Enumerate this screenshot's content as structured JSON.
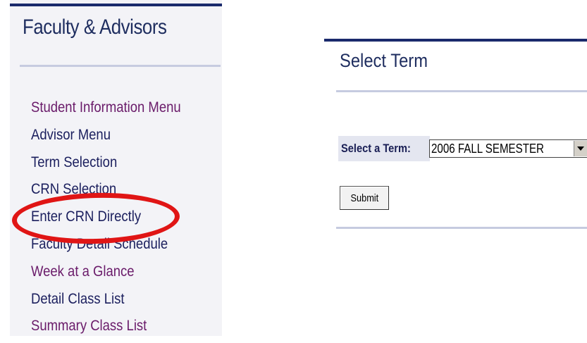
{
  "left_panel": {
    "title": "Faculty & Advisors",
    "menu": [
      {
        "label": "Student Information Menu",
        "visited": true
      },
      {
        "label": "Advisor Menu",
        "visited": false
      },
      {
        "label": "Term Selection",
        "visited": false
      },
      {
        "label": "CRN Selection",
        "visited": false
      },
      {
        "label": "Enter CRN Directly",
        "visited": false,
        "highlighted": true
      },
      {
        "label": "Faculty Detail Schedule",
        "visited": false
      },
      {
        "label": "Week at a Glance",
        "visited": true
      },
      {
        "label": "Detail Class List",
        "visited": false
      },
      {
        "label": "Summary Class List",
        "visited": true
      }
    ]
  },
  "right_panel": {
    "title": "Select Term",
    "term_label": "Select a Term:",
    "term_select_value": "2006 FALL SEMESTER",
    "submit_label": "Submit"
  },
  "colors": {
    "header_blue": "#1a2a6c",
    "visited_link": "#6a1b6a",
    "link": "#1b1f5e",
    "highlight_red": "#e01515"
  }
}
